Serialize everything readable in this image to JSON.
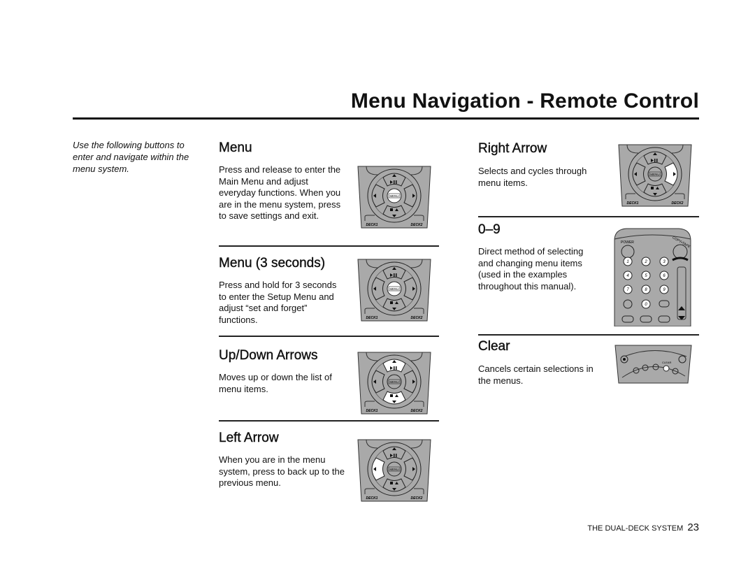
{
  "title": "Menu Navigation - Remote Control",
  "intro": "Use the following buttons to enter and navigate within the menu system.",
  "sections": [
    {
      "heading": "Menu",
      "text": "Press and release to enter the Main Menu and adjust everyday functions. When you are in the menu system, press to save settings and exit.",
      "highlight": "menu"
    },
    {
      "heading": "Menu (3 seconds)",
      "text": "Press and hold for 3 seconds to enter the Setup Menu and adjust “set and forget” functions.",
      "highlight": "menu"
    },
    {
      "heading": "Up/Down Arrows",
      "text": "Moves up or down the list of menu items.",
      "highlight": "updown"
    },
    {
      "heading": "Left Arrow",
      "text": "When you are in the menu system, press to back up to the previous menu.",
      "highlight": "left"
    },
    {
      "heading": "Right Arrow",
      "text": "Selects and cycles through menu items.",
      "highlight": "right"
    },
    {
      "heading": "0–9",
      "text": "Direct method of selecting and changing menu items (used in the examples throughout this manual)."
    },
    {
      "heading": "Clear",
      "text": "Cancels certain selections in the menus."
    }
  ],
  "remote_labels": {
    "deck1": "DECK1",
    "deck2": "DECK2",
    "menu": "MENU",
    "power": "POWER",
    "copy_tape": "COPY•TAPE",
    "clear": "CLEAR"
  },
  "footer": {
    "label": "THE DUAL-DECK SYSTEM",
    "page": "23"
  },
  "colors": {
    "remote_body": "#a9a9a9",
    "highlight": "#ffffff"
  }
}
